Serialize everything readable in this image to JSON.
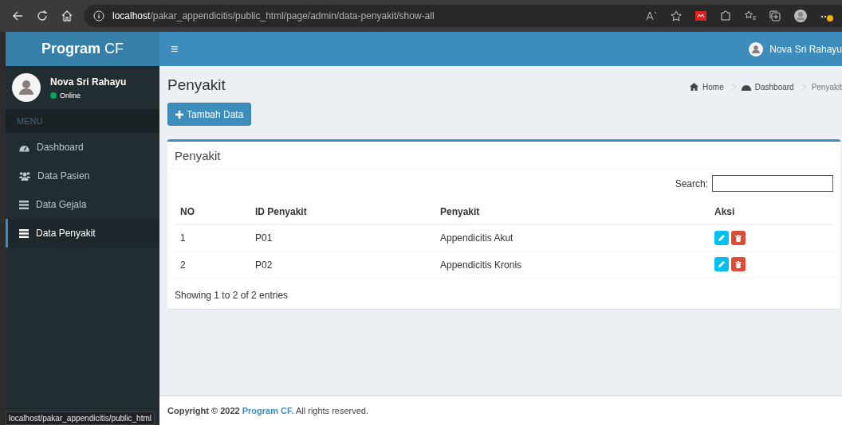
{
  "browser": {
    "url_host": "localhost",
    "url_path": "/pakar_appendicitis/public_html/page/admin/data-penyakit/show-all",
    "status_url": "localhost/pakar_appendicitis/public_html"
  },
  "brand": {
    "bold": "Program",
    "light": "CF"
  },
  "header": {
    "menu_toggle": "≡",
    "user_name": "Nova Sri Rahayu"
  },
  "user_panel": {
    "name": "Nova Sri Rahayu",
    "status": "Online",
    "color": "#00a65a"
  },
  "sidebar": {
    "header": "MENU",
    "items": [
      {
        "label": "Dashboard",
        "kind": "dashboard",
        "selected": false
      },
      {
        "label": "Data Pasien",
        "kind": "users",
        "selected": false
      },
      {
        "label": "Data Gejala",
        "kind": "list",
        "selected": false
      },
      {
        "label": "Data Penyakit",
        "kind": "list",
        "selected": true
      }
    ]
  },
  "page": {
    "title": "Penyakit",
    "breadcrumb": [
      {
        "label": "Home",
        "kind": "home"
      },
      {
        "label": "Dashboard",
        "kind": "dashboard"
      },
      {
        "label": "Penyakit",
        "kind": "current"
      }
    ],
    "add_button": "Tambah Data"
  },
  "box": {
    "title": "Penyakit",
    "search_label": "Search:",
    "columns": [
      "NO",
      "ID Penyakit",
      "Penyakit",
      "Aksi"
    ],
    "rows": [
      {
        "no": "1",
        "id": "P01",
        "name": "Appendicitis Akut"
      },
      {
        "no": "2",
        "id": "P02",
        "name": "Appendicitis Kronis"
      }
    ],
    "info": "Showing 1 to 2 of 2 entries"
  },
  "footer": {
    "prefix": "Copyright © 2022",
    "brand": "Program CF.",
    "suffix": "All rights reserved."
  }
}
